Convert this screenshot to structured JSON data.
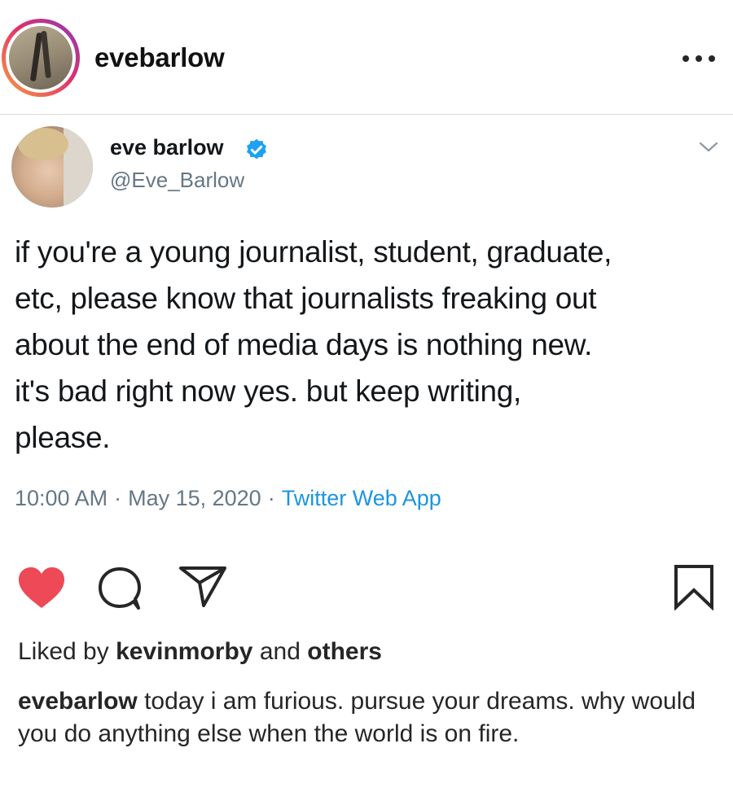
{
  "post": {
    "username": "evebarlow"
  },
  "tweet": {
    "name": "eve barlow",
    "handle": "@Eve_Barlow",
    "text": "if you're a young journalist, student, graduate,\netc, please know that journalists freaking out\nabout the end of media days is nothing new.\nit's bad right now yes. but keep writing,\nplease.",
    "time": "10:00 AM",
    "separator": "·",
    "date": "May 15, 2020",
    "source": "Twitter Web App",
    "verified_color": "#1da1f2",
    "source_color": "#1b95e0"
  },
  "actions": {
    "like_icon": "heart-filled-icon",
    "like_color": "#ed4956",
    "comment_icon": "comment-icon",
    "share_icon": "paper-plane-icon",
    "save_icon": "bookmark-icon"
  },
  "likes": {
    "prefix": "Liked by",
    "user": "kevinmorby",
    "middle": "and",
    "others": "others"
  },
  "caption": {
    "username": "evebarlow",
    "text": "today i am furious. pursue your dreams. why would you do anything else when the world is on fire."
  }
}
